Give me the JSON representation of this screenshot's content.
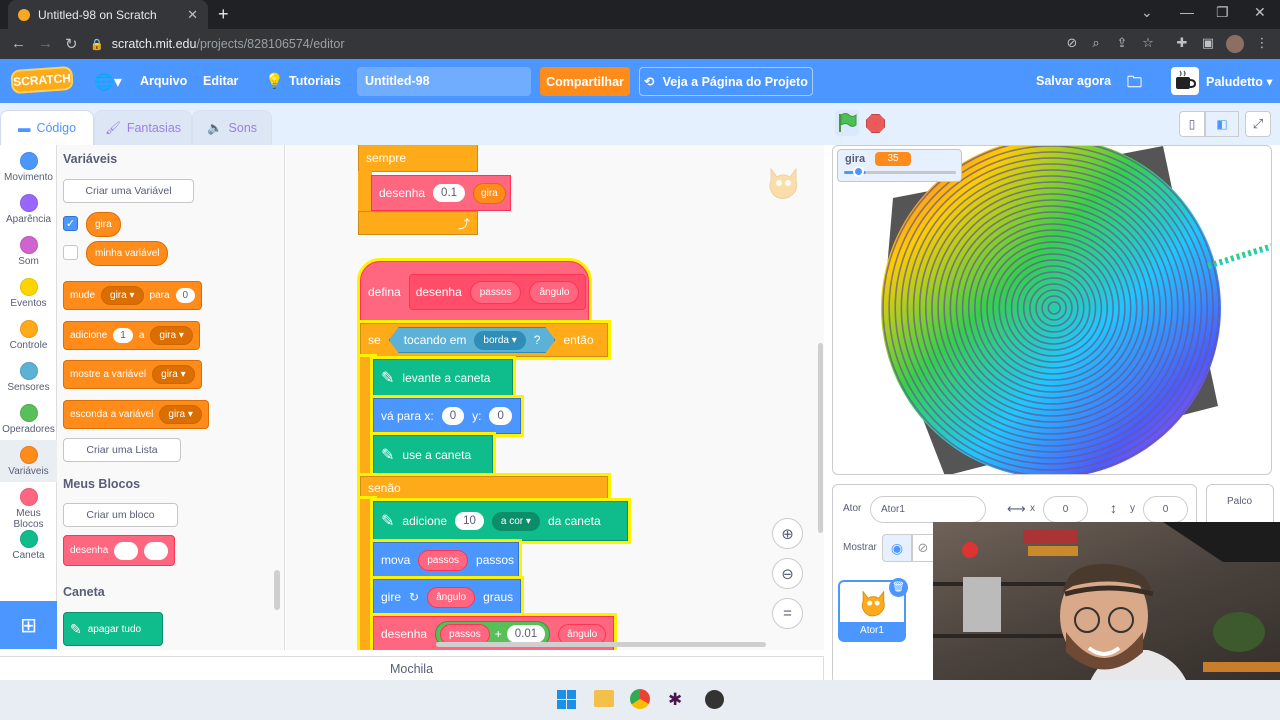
{
  "browser": {
    "tab_title": "Untitled-98 on Scratch",
    "url_host": "scratch.mit.edu",
    "url_path": "/projects/828106574/editor"
  },
  "menubar": {
    "logo": "SCRATCH",
    "file": "Arquivo",
    "edit": "Editar",
    "tutorials": "Tutoriais",
    "project_title": "Untitled-98",
    "share": "Compartilhar",
    "project_page": "Veja a Página do Projeto",
    "save_now": "Salvar agora",
    "username": "Paludetto"
  },
  "tabs": {
    "code": "Código",
    "costumes": "Fantasias",
    "sounds": "Sons"
  },
  "categories": [
    {
      "label": "Movimento",
      "color": "#4c97ff"
    },
    {
      "label": "Aparência",
      "color": "#9966ff"
    },
    {
      "label": "Som",
      "color": "#cf63cf"
    },
    {
      "label": "Eventos",
      "color": "#ffd500"
    },
    {
      "label": "Controle",
      "color": "#ffab19"
    },
    {
      "label": "Sensores",
      "color": "#5cb1d6"
    },
    {
      "label": "Operadores",
      "color": "#59c059"
    },
    {
      "label": "Variáveis",
      "color": "#ff8c1a"
    },
    {
      "label": "Meus Blocos",
      "color": "#ff6680"
    },
    {
      "label": "Caneta",
      "color": "#0fbd8c"
    }
  ],
  "palette": {
    "variables_heading": "Variáveis",
    "make_variable": "Criar uma Variável",
    "var1": "gira",
    "var2": "minha variável",
    "set_block": {
      "label": "mude",
      "var": "gira",
      "to": "para",
      "value": "0"
    },
    "change_block": {
      "label": "adicione",
      "value": "1",
      "a": "a",
      "var": "gira"
    },
    "show_block": {
      "label": "mostre a variável",
      "var": "gira"
    },
    "hide_block": {
      "label": "esconda a variável",
      "var": "gira"
    },
    "make_list": "Criar uma Lista",
    "myblocks_heading": "Meus Blocos",
    "make_block": "Criar um bloco",
    "custom_block": "desenha",
    "pen_heading": "Caneta",
    "clear_block": "apagar tudo"
  },
  "script": {
    "forever": "sempre",
    "call1": {
      "label": "desenha",
      "value": "0.1",
      "var": "gira"
    },
    "define": {
      "label": "defina",
      "name": "desenha",
      "p1": "passos",
      "p2": "ângulo"
    },
    "if": {
      "label": "se",
      "touching": "tocando em",
      "target": "borda",
      "q": "?",
      "then": "então"
    },
    "pen_up": "levante a caneta",
    "goto": {
      "label": "vá para x:",
      "x": "0",
      "ylabel": "y:",
      "y": "0"
    },
    "pen_down": "use a caneta",
    "else": "senão",
    "change_pen": {
      "label": "adicione",
      "value": "10",
      "param": "a cor",
      "suffix": "da caneta"
    },
    "move": {
      "label": "mova",
      "param": "passos",
      "suffix": "passos"
    },
    "turn": {
      "label": "gire",
      "param": "ângulo",
      "suffix": "graus"
    },
    "call2": {
      "label": "desenha",
      "p1": "passos",
      "plus": "+",
      "value": "0.01",
      "p2": "ângulo"
    }
  },
  "backpack": "Mochila",
  "stage": {
    "monitor_name": "gira",
    "monitor_value": "35"
  },
  "sprite_info": {
    "sprite_label": "Ator",
    "sprite_name": "Ator1",
    "x_label": "x",
    "x": "0",
    "y_label": "y",
    "y": "0",
    "show_label": "Mostrar",
    "thumb_label": "Ator1",
    "stage_label": "Palco"
  }
}
